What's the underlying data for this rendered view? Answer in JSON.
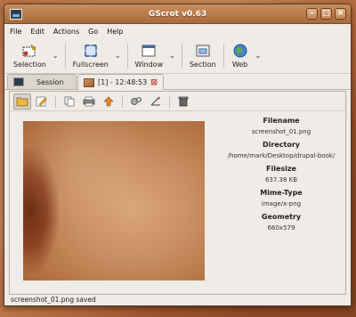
{
  "window": {
    "title": "GScrot v0.63"
  },
  "menu": [
    "File",
    "Edit",
    "Actions",
    "Go",
    "Help"
  ],
  "toolbar": {
    "selection": "Selection",
    "fullscreen": "Fullscreen",
    "window": "Window",
    "section": "Section",
    "web": "Web"
  },
  "tabs": [
    {
      "label": "Session"
    },
    {
      "label": "[1] - 12:48:53"
    }
  ],
  "info": {
    "filename_label": "Filename",
    "filename": "screenshot_01.png",
    "directory_label": "Directory",
    "directory": "/home/mark/Desktop/drupal-book/",
    "filesize_label": "Filesize",
    "filesize": "637.38 KB",
    "mimetype_label": "Mime-Type",
    "mimetype": "image/x-png",
    "geometry_label": "Geometry",
    "geometry": "660x579"
  },
  "status": "screenshot_01.png saved",
  "colors": {
    "accent": "#a96a3b",
    "close": "#c0392b"
  }
}
